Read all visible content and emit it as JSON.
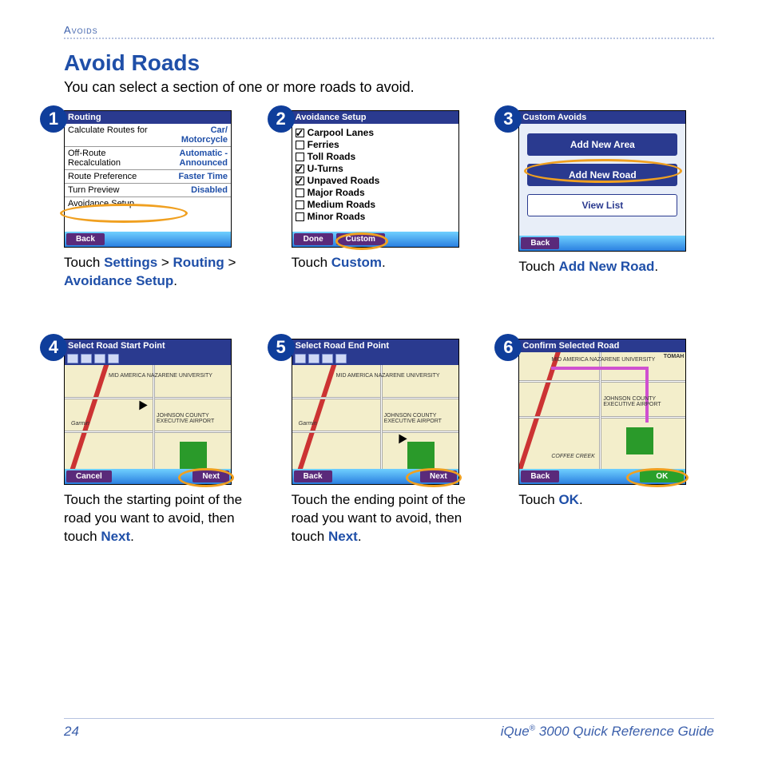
{
  "header": {
    "section": "Avoids"
  },
  "title": "Avoid Roads",
  "intro": "You can select a section of one or more roads to avoid.",
  "steps": [
    {
      "num": "1",
      "screen_title": "Routing",
      "settings": [
        {
          "label": "Calculate Routes for",
          "value": "Car/\nMotorcycle"
        },
        {
          "label": "Off-Route\nRecalculation",
          "value": "Automatic -\nAnnounced"
        },
        {
          "label": "Route Preference",
          "value": "Faster Time"
        },
        {
          "label": "Turn Preview",
          "value": "Disabled"
        },
        {
          "label": "Avoidance Setup",
          "value": ""
        }
      ],
      "footer_buttons": [
        "Back"
      ],
      "caption_pre": "Touch ",
      "caption_kw": "Settings > Routing > Avoidance Setup",
      "caption_post": "."
    },
    {
      "num": "2",
      "screen_title": "Avoidance Setup",
      "checks": [
        {
          "label": "Carpool Lanes",
          "checked": true
        },
        {
          "label": "Ferries",
          "checked": false
        },
        {
          "label": "Toll Roads",
          "checked": false
        },
        {
          "label": "U-Turns",
          "checked": true
        },
        {
          "label": "Unpaved Roads",
          "checked": true
        },
        {
          "label": "Major Roads",
          "checked": false
        },
        {
          "label": "Medium Roads",
          "checked": false
        },
        {
          "label": "Minor Roads",
          "checked": false
        }
      ],
      "footer_buttons": [
        "Done",
        "Custom"
      ],
      "caption_pre": "Touch ",
      "caption_kw": "Custom",
      "caption_post": "."
    },
    {
      "num": "3",
      "screen_title": "Custom Avoids",
      "buttons": [
        {
          "label": "Add New Area",
          "style": "primary"
        },
        {
          "label": "Add New Road",
          "style": "primary",
          "highlight": true
        },
        {
          "label": "View List",
          "style": "secondary"
        }
      ],
      "footer_buttons": [
        "Back"
      ],
      "caption_pre": "Touch ",
      "caption_kw": "Add New Road",
      "caption_post": "."
    },
    {
      "num": "4",
      "screen_title": "Select Road Start Point",
      "map_labels": [
        "MID AMERICA NAZARENE UNIVERSITY",
        "JOHNSON COUNTY EXECUTIVE AIRPORT",
        "Garmin"
      ],
      "footer_buttons": [
        "Cancel",
        "Next"
      ],
      "highlight_button": "Next",
      "caption_pre": "Touch the starting point of the road you want to avoid, then touch ",
      "caption_kw": "Next",
      "caption_post": "."
    },
    {
      "num": "5",
      "screen_title": "Select Road End Point",
      "map_labels": [
        "MID AMERICA NAZARENE UNIVERSITY",
        "JOHNSON COUNTY EXECUTIVE AIRPORT",
        "Garmin"
      ],
      "footer_buttons": [
        "Back",
        "Next"
      ],
      "highlight_button": "Next",
      "caption_pre": "Touch the ending point of the road you want to avoid, then touch ",
      "caption_kw": "Next",
      "caption_post": "."
    },
    {
      "num": "6",
      "screen_title": "Confirm Selected Road",
      "map_labels": [
        "MID AMERICA NAZARENE UNIVERSITY",
        "JOHNSON COUNTY EXECUTIVE AIRPORT",
        "COFFEE CREEK",
        "TOMAH"
      ],
      "footer_buttons": [
        "Back",
        "OK"
      ],
      "highlight_button": "OK",
      "ok_green": true,
      "caption_pre": "Touch ",
      "caption_kw": "OK",
      "caption_post": "."
    }
  ],
  "footer": {
    "page": "24",
    "product": "iQue",
    "reg": "®",
    "rest": " 3000 Quick Reference Guide"
  }
}
